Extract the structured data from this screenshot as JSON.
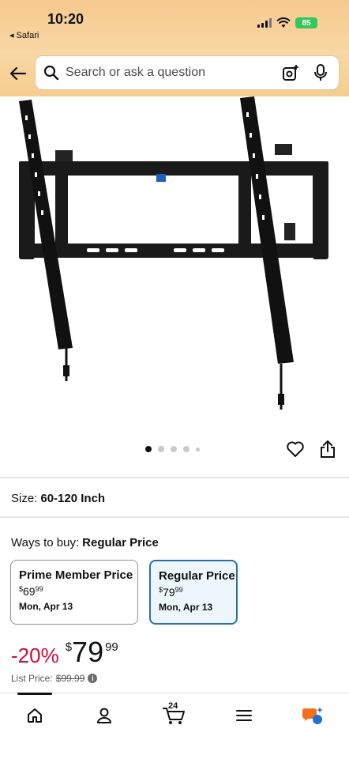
{
  "status": {
    "time": "10:20",
    "back_app": "◂ Safari",
    "battery": "85"
  },
  "search": {
    "placeholder": "Search or ask a question"
  },
  "product": {
    "image_alt": "TV wall mount",
    "carousel": {
      "count": 5,
      "active": 0
    }
  },
  "size": {
    "label": "Size:",
    "value": "60-120 Inch"
  },
  "ways_to_buy": {
    "label": "Ways to buy:",
    "value": "Regular Price"
  },
  "options": [
    {
      "title": "Prime Member Price",
      "currency": "$",
      "whole": "69",
      "cents": "99",
      "date": "Mon, Apr 13",
      "selected": false
    },
    {
      "title": "Regular Price",
      "currency": "$",
      "whole": "79",
      "cents": "99",
      "date": "Mon, Apr 13",
      "selected": true
    }
  ],
  "price": {
    "discount": "-20%",
    "currency": "$",
    "whole": "79",
    "fraction": "99",
    "list_label": "List Price:",
    "list_value": "$99.99"
  },
  "tabbar": {
    "cart_count": "24",
    "items": [
      "home-icon",
      "account-icon",
      "cart-icon",
      "menu-icon",
      "rufus-icon"
    ]
  },
  "colors": {
    "discount": "#cc0c39",
    "selected_border": "#2b6ea6",
    "header": "#f6c98f"
  }
}
